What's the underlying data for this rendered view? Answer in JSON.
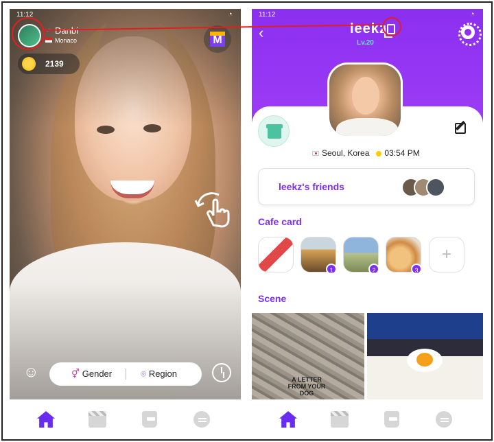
{
  "left_phone": {
    "status_time": "11:12",
    "user": {
      "name": "Danbi",
      "region": "Monaco"
    },
    "coins": "2139",
    "filter": {
      "gender_label": "Gender",
      "region_label": "Region"
    }
  },
  "right_phone": {
    "status_time": "11:12",
    "title": "leekz",
    "level": "Lv.20",
    "location": {
      "city": "Seoul, Korea",
      "time": "03:54 PM"
    },
    "friends_label": "leekz's friends",
    "cafe_card": {
      "title": "Cafe card",
      "badges": [
        "1",
        "2",
        "3"
      ],
      "add_symbol": "+"
    },
    "scene_title": "Scene",
    "scene_caption": "A LETTER FROM YOUR DOG"
  },
  "icons": {
    "home": "home-icon",
    "reels": "film-icon",
    "cup": "cup-icon",
    "chat": "chat-icon"
  },
  "colors": {
    "accent": "#7b2ff0",
    "highlight": "#e0201f",
    "header": "#8b2ff0"
  }
}
